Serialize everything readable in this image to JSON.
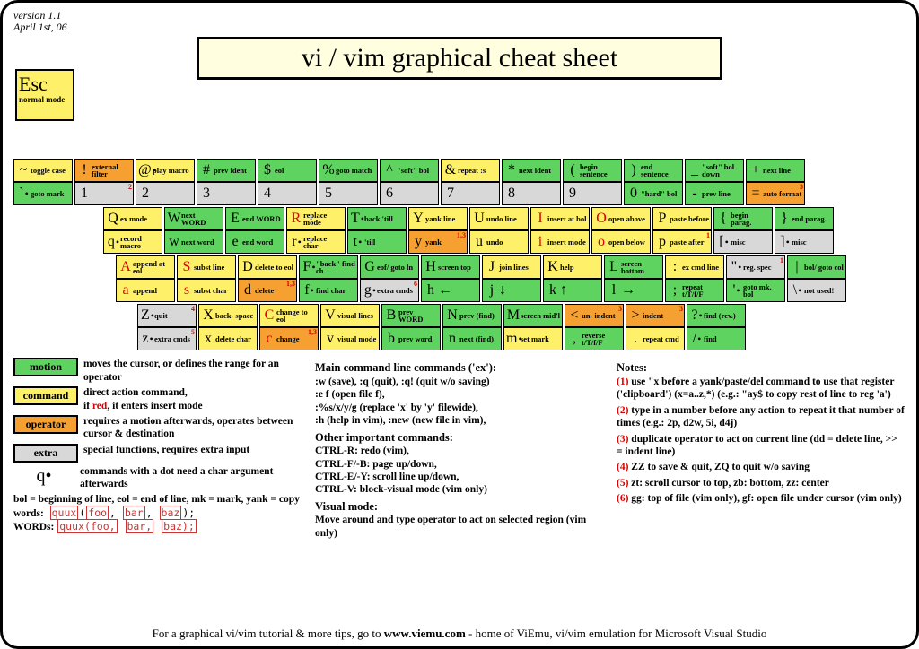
{
  "meta": {
    "version": "version 1.1",
    "date": "April 1st, 06",
    "title": "vi / vim graphical cheat sheet"
  },
  "esc": {
    "key": "Esc",
    "label": "normal mode"
  },
  "rows": [
    [
      {
        "u": [
          "~",
          "toggle case",
          "cmd"
        ],
        "l": [
          "`",
          "goto mark",
          "motion",
          true
        ]
      },
      {
        "u": [
          "!",
          "external filter",
          "op"
        ],
        "l": [
          "1",
          "",
          "extra",
          "",
          "2"
        ]
      },
      {
        "u": [
          "@",
          "play macro",
          "cmd",
          true
        ],
        "l": [
          "2",
          "",
          "extra"
        ]
      },
      {
        "u": [
          "#",
          "prev ident",
          "motion"
        ],
        "l": [
          "3",
          "",
          "extra"
        ]
      },
      {
        "u": [
          "$",
          "eol",
          "motion"
        ],
        "l": [
          "4",
          "",
          "extra"
        ]
      },
      {
        "u": [
          "%",
          "goto match",
          "motion"
        ],
        "l": [
          "5",
          "",
          "extra"
        ]
      },
      {
        "u": [
          "^",
          "\"soft\" bol",
          "motion"
        ],
        "l": [
          "6",
          "",
          "extra"
        ]
      },
      {
        "u": [
          "&",
          "repeat :s",
          "cmd"
        ],
        "l": [
          "7",
          "",
          "extra"
        ]
      },
      {
        "u": [
          "*",
          "next ident",
          "motion"
        ],
        "l": [
          "8",
          "",
          "extra"
        ]
      },
      {
        "u": [
          "(",
          "begin sentence",
          "motion"
        ],
        "l": [
          "9",
          "",
          "extra"
        ]
      },
      {
        "u": [
          ")",
          "end sentence",
          "motion"
        ],
        "l": [
          "0",
          "\"hard\" bol",
          "motion"
        ]
      },
      {
        "u": [
          "_",
          "\"soft\" bol down",
          "motion"
        ],
        "l": [
          "-",
          "prev line",
          "motion"
        ]
      },
      {
        "u": [
          "+",
          "next line",
          "motion"
        ],
        "l": [
          "=",
          "auto format",
          "op",
          "",
          "3"
        ]
      }
    ],
    [
      {
        "u": [
          "Q",
          "ex mode",
          "cmd"
        ],
        "l": [
          "q",
          "record macro",
          "cmd",
          true
        ]
      },
      {
        "u": [
          "W",
          "next WORD",
          "motion"
        ],
        "l": [
          "w",
          "next word",
          "motion"
        ]
      },
      {
        "u": [
          "E",
          "end WORD",
          "motion"
        ],
        "l": [
          "e",
          "end word",
          "motion"
        ]
      },
      {
        "u": [
          "R",
          "replace mode",
          "cmd",
          "ins"
        ],
        "l": [
          "r",
          "replace char",
          "cmd",
          true
        ]
      },
      {
        "u": [
          "T",
          "back 'till",
          "motion",
          true
        ],
        "l": [
          "t",
          "'till",
          "motion",
          true
        ]
      },
      {
        "u": [
          "Y",
          "yank line",
          "cmd"
        ],
        "l": [
          "y",
          "yank",
          "op",
          "",
          "1,3"
        ]
      },
      {
        "u": [
          "U",
          "undo line",
          "cmd"
        ],
        "l": [
          "u",
          "undo",
          "cmd"
        ]
      },
      {
        "u": [
          "I",
          "insert at bol",
          "cmd",
          "ins"
        ],
        "l": [
          "i",
          "insert mode",
          "cmd",
          "ins"
        ]
      },
      {
        "u": [
          "O",
          "open above",
          "cmd",
          "ins"
        ],
        "l": [
          "o",
          "open below",
          "cmd",
          "ins"
        ]
      },
      {
        "u": [
          "P",
          "paste before",
          "cmd"
        ],
        "l": [
          "p",
          "paste after",
          "cmd",
          "",
          "1"
        ]
      },
      {
        "u": [
          "{",
          "begin parag.",
          "motion"
        ],
        "l": [
          "[",
          "misc",
          "extra",
          true
        ]
      },
      {
        "u": [
          "}",
          "end parag.",
          "motion"
        ],
        "l": [
          "]",
          "misc",
          "extra",
          true
        ]
      }
    ],
    [
      {
        "u": [
          "A",
          "append at eol",
          "cmd",
          "ins"
        ],
        "l": [
          "a",
          "append",
          "cmd",
          "ins"
        ]
      },
      {
        "u": [
          "S",
          "subst line",
          "cmd",
          "ins"
        ],
        "l": [
          "s",
          "subst char",
          "cmd",
          "ins"
        ]
      },
      {
        "u": [
          "D",
          "delete to eol",
          "cmd"
        ],
        "l": [
          "d",
          "delete",
          "op",
          "",
          "1,3"
        ]
      },
      {
        "u": [
          "F",
          "\"back\" find ch",
          "motion",
          true
        ],
        "l": [
          "f",
          "find char",
          "motion",
          true
        ]
      },
      {
        "u": [
          "G",
          "eof/ goto ln",
          "motion"
        ],
        "l": [
          "g",
          "extra cmds",
          "extra",
          true,
          "6"
        ]
      },
      {
        "u": [
          "H",
          "screen top",
          "motion"
        ],
        "l": [
          "h",
          "←",
          "motion",
          "",
          "",
          "arrow"
        ]
      },
      {
        "u": [
          "J",
          "join lines",
          "cmd"
        ],
        "l": [
          "j",
          "↓",
          "motion",
          "",
          "",
          "arrow"
        ]
      },
      {
        "u": [
          "K",
          "help",
          "cmd"
        ],
        "l": [
          "k",
          "↑",
          "motion",
          "",
          "",
          "arrow"
        ]
      },
      {
        "u": [
          "L",
          "screen bottom",
          "motion"
        ],
        "l": [
          "l",
          "→",
          "motion",
          "",
          "",
          "arrow"
        ]
      },
      {
        "u": [
          ":",
          "ex cmd line",
          "cmd"
        ],
        "l": [
          ";",
          "repeat t/T/f/F",
          "motion"
        ]
      },
      {
        "u": [
          "\"",
          "reg. spec",
          "extra",
          true,
          "1"
        ],
        "l": [
          "'",
          "goto mk. bol",
          "motion",
          true
        ]
      },
      {
        "u": [
          "|",
          "bol/ goto col",
          "motion"
        ],
        "l": [
          "\\",
          "not used!",
          "extra",
          true
        ]
      }
    ],
    [
      {
        "u": [
          "Z",
          "quit",
          "extra",
          true,
          "4"
        ],
        "l": [
          "z",
          "extra cmds",
          "extra",
          true,
          "5"
        ]
      },
      {
        "u": [
          "X",
          "back- space",
          "cmd"
        ],
        "l": [
          "x",
          "delete char",
          "cmd"
        ]
      },
      {
        "u": [
          "C",
          "change to eol",
          "cmd",
          "ins"
        ],
        "l": [
          "c",
          "change",
          "op",
          "ins",
          "1,3"
        ]
      },
      {
        "u": [
          "V",
          "visual lines",
          "cmd"
        ],
        "l": [
          "v",
          "visual mode",
          "cmd"
        ]
      },
      {
        "u": [
          "B",
          "prev WORD",
          "motion"
        ],
        "l": [
          "b",
          "prev word",
          "motion"
        ]
      },
      {
        "u": [
          "N",
          "prev (find)",
          "motion"
        ],
        "l": [
          "n",
          "next (find)",
          "motion"
        ]
      },
      {
        "u": [
          "M",
          "screen mid'l",
          "motion"
        ],
        "l": [
          "m",
          "set mark",
          "cmd",
          true
        ]
      },
      {
        "u": [
          "<",
          "un- indent",
          "op",
          "",
          "3"
        ],
        "l": [
          ",",
          "reverse t/T/f/F",
          "motion"
        ]
      },
      {
        "u": [
          ">",
          "indent",
          "op",
          "",
          "3"
        ],
        "l": [
          ".",
          "repeat cmd",
          "cmd"
        ]
      },
      {
        "u": [
          "?",
          "find (rev.)",
          "motion",
          true
        ],
        "l": [
          "/",
          "find",
          "motion",
          true
        ]
      }
    ]
  ],
  "legend": [
    {
      "name": "motion",
      "cls": "motion",
      "text": "moves the cursor, or defines the range for an operator"
    },
    {
      "name": "command",
      "cls": "cmd",
      "text": "direct action command, if red, it enters insert mode"
    },
    {
      "name": "operator",
      "cls": "op",
      "text": "requires a motion afterwards, operates between cursor & destination"
    },
    {
      "name": "extra",
      "cls": "extra",
      "text": "special functions, requires extra input"
    }
  ],
  "qdot": "commands with a dot need a char argument afterwards",
  "abbr": "bol = beginning of line, eol = end of line, mk = mark, yank = copy",
  "words_label": "words:",
  "WORDS_label": "WORDs:",
  "maincmds": {
    "h1": "Main command line commands ('ex'):",
    "l1": ":w (save), :q (quit), :q! (quit w/o saving)\n:e f (open file f),\n:%s/x/y/g (replace 'x' by 'y' filewide),\n:h (help in vim), :new (new file in vim),",
    "h2": "Other important commands:",
    "l2": "CTRL-R: redo (vim),\nCTRL-F/-B: page up/down,\nCTRL-E/-Y: scroll line up/down,\nCTRL-V: block-visual mode (vim only)",
    "h3": "Visual mode:",
    "l3": "Move around and type operator to act on selected region (vim only)"
  },
  "notes": {
    "h": "Notes:",
    "n": [
      "(1) use \"x before a yank/paste/del command to use that register ('clipboard') (x=a..z,*) (e.g.: \"ay$ to copy rest of line to reg 'a')",
      "(2) type in a number before any action to repeat it that number of times (e.g.: 2p, d2w, 5i, d4j)",
      "(3) duplicate operator to act on current line (dd = delete line, >> = indent line)",
      "(4) ZZ to save & quit, ZQ to quit w/o saving",
      "(5) zt: scroll cursor to top, zb: bottom, zz: center",
      "(6) gg: top of file (vim only), gf: open file under cursor (vim only)"
    ]
  },
  "footer": {
    "pre": "For a graphical vi/vim tutorial & more tips, go to ",
    "url": "www.viemu.com",
    "post": " - home of ViEmu, vi/vim emulation for Microsoft Visual Studio"
  }
}
